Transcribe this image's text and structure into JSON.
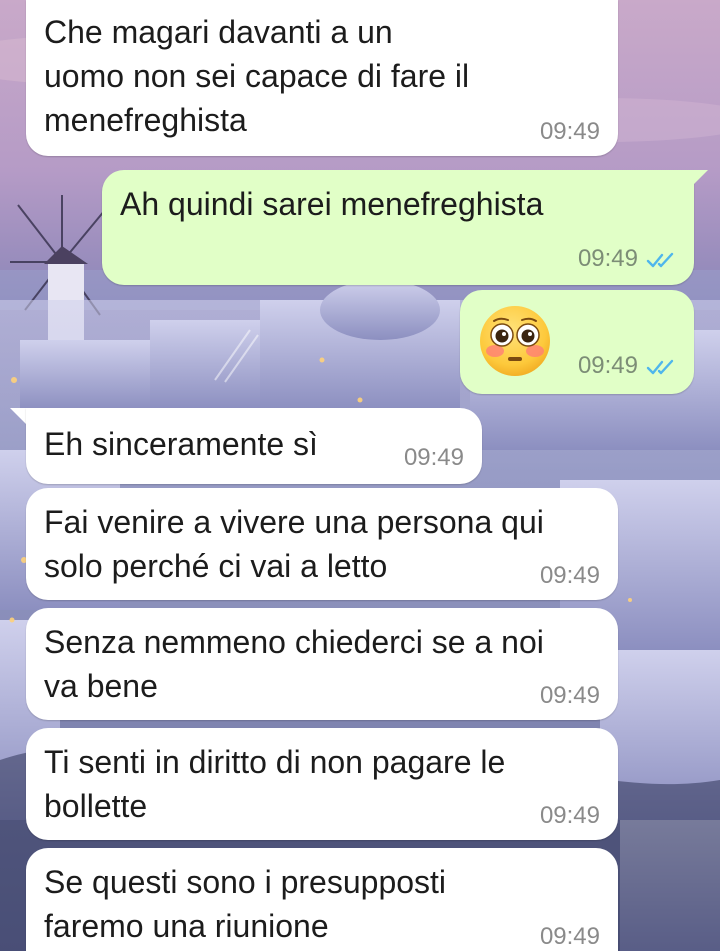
{
  "conversation": {
    "messages": [
      {
        "direction": "in",
        "text": "Che magari davanti a un\nuomo non sei capace di fare il\nmenefreghista",
        "time": "09:49"
      },
      {
        "direction": "out",
        "text": "Ah quindi sarei menefreghista",
        "time": "09:49",
        "status": "read"
      },
      {
        "direction": "out",
        "emoji": "flushed-face",
        "time": "09:49",
        "status": "read"
      },
      {
        "direction": "in",
        "text": "Eh sinceramente sì",
        "time": "09:49"
      },
      {
        "direction": "in",
        "text": "Fai venire a vivere una persona qui\nsolo perché ci vai a letto",
        "time": "09:49"
      },
      {
        "direction": "in",
        "text": "Senza nemmeno chiederci se a noi\nva bene",
        "time": "09:49"
      },
      {
        "direction": "in",
        "text": "Ti senti in diritto di non pagare le\nbollette",
        "time": "09:49"
      },
      {
        "direction": "in",
        "text": "Se questi sono i presupposti\nfaremo una riunione",
        "time": "09:49"
      }
    ]
  },
  "colors": {
    "incoming_bubble": "#ffffff",
    "outgoing_bubble": "#e1ffc7",
    "read_ticks": "#4fb6ec"
  }
}
